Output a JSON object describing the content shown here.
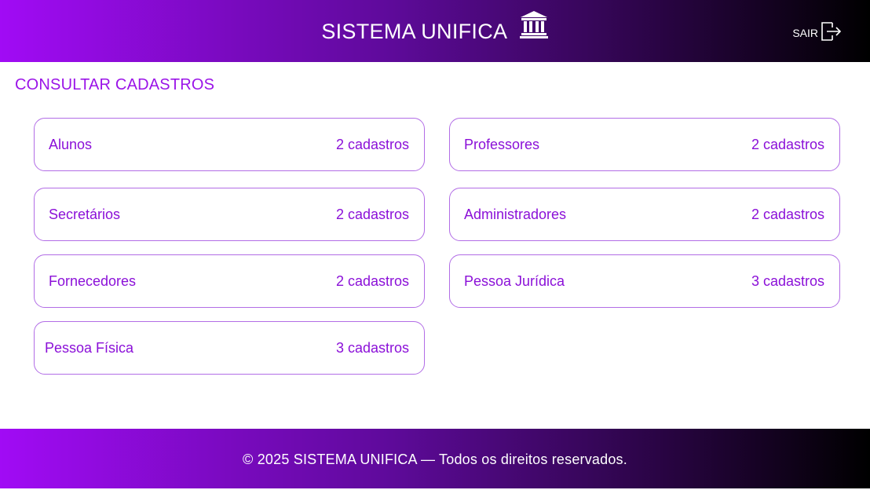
{
  "header": {
    "title": "SISTEMA UNIFICA",
    "logo_icon": "bank-building-icon",
    "logout_label": "SAIR",
    "logout_icon": "logout-icon",
    "gradient_colors": [
      "#a10bf5",
      "#5e0a9a",
      "#000000"
    ]
  },
  "main": {
    "section_title": "CONSULTAR CADASTROS",
    "accent_color": "#9b14e8",
    "cards": [
      {
        "label": "Alunos",
        "count": "2 cadastros"
      },
      {
        "label": "Professores",
        "count": "2 cadastros"
      },
      {
        "label": "Secretários",
        "count": "2 cadastros"
      },
      {
        "label": "Administradores",
        "count": "2 cadastros"
      },
      {
        "label": "Fornecedores",
        "count": "2 cadastros"
      },
      {
        "label": "Pessoa Jurídica",
        "count": "3 cadastros"
      },
      {
        "label": "Pessoa Física",
        "count": "3 cadastros"
      }
    ]
  },
  "footer": {
    "text": "© 2025 SISTEMA UNIFICA — Todos os direitos reservados."
  }
}
